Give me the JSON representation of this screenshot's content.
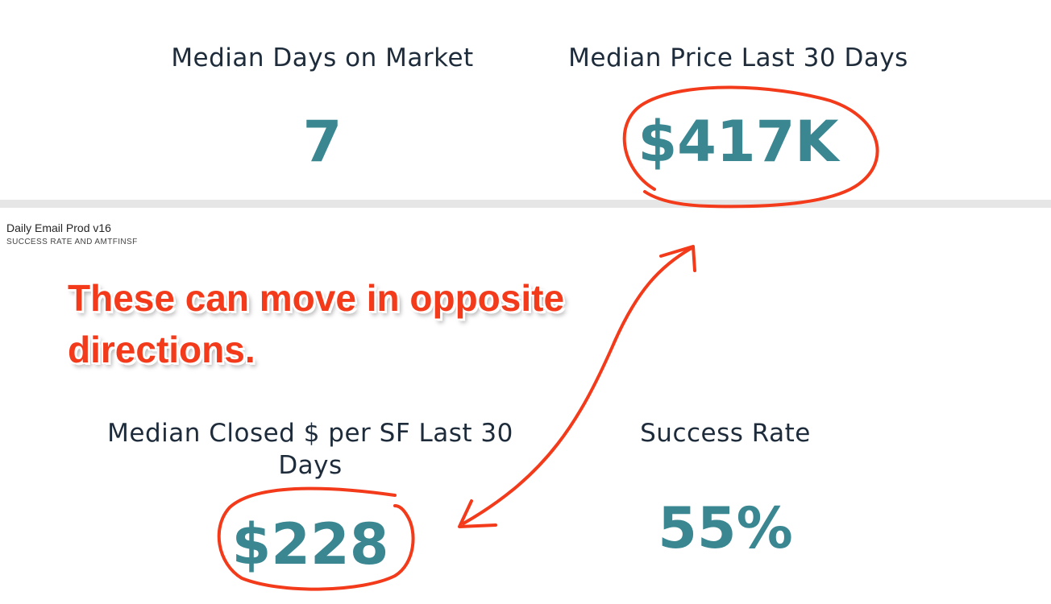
{
  "top_cards": {
    "days_on_market": {
      "label": "Median Days on Market",
      "value": "7"
    },
    "median_price": {
      "label": "Median Price Last 30 Days",
      "value": "$417K"
    }
  },
  "report": {
    "title": "Daily Email Prod v16",
    "subtitle": "SUCCESS RATE AND AMTFINSF"
  },
  "bottom_cards": {
    "closed_per_sf": {
      "label_line1": "Median Closed $ per SF Last 30",
      "label_line2": "Days",
      "value": "$228"
    },
    "success_rate": {
      "label": "Success Rate",
      "value": "55%"
    }
  },
  "annotation": {
    "text": "These can move in opposite directions.",
    "ink_color": "#f33a1a"
  },
  "colors": {
    "kpi_value": "#3a8792",
    "kpi_label": "#1d2b3a",
    "divider": "#e6e6e6"
  }
}
